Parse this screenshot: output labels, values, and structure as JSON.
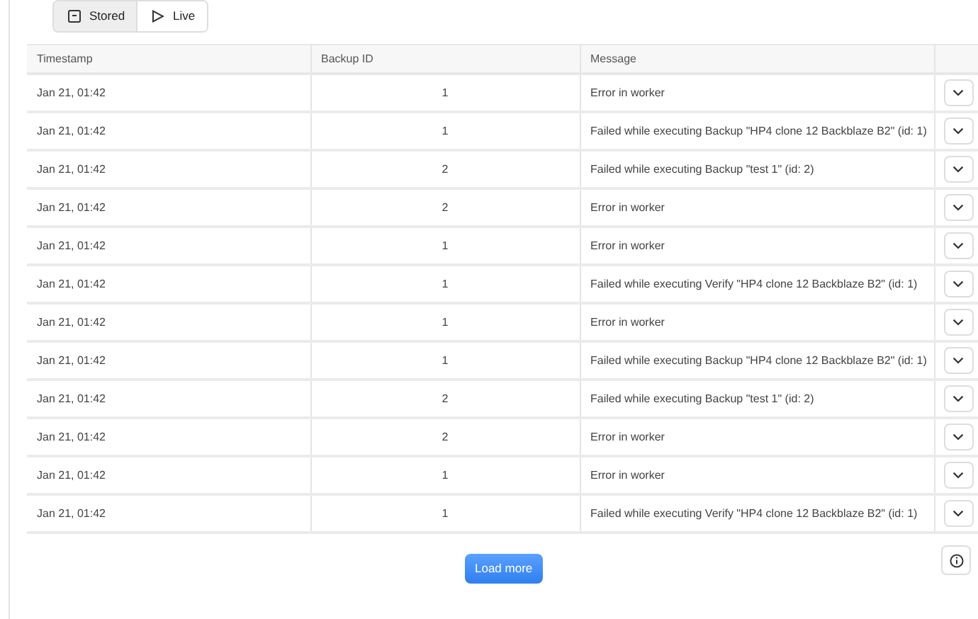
{
  "view_toggle": [
    {
      "label": "Stored",
      "selected": true
    },
    {
      "label": "Live",
      "selected": false
    }
  ],
  "table": {
    "columns": [
      "Timestamp",
      "Backup ID",
      "Message"
    ],
    "rows": [
      {
        "timestamp": "Jan 21, 01:42",
        "backup_id": "1",
        "message": "Error in worker"
      },
      {
        "timestamp": "Jan 21, 01:42",
        "backup_id": "1",
        "message": "Failed while executing Backup \"HP4 clone 12 Backblaze B2\" (id: 1)"
      },
      {
        "timestamp": "Jan 21, 01:42",
        "backup_id": "2",
        "message": "Failed while executing Backup \"test 1\" (id: 2)"
      },
      {
        "timestamp": "Jan 21, 01:42",
        "backup_id": "2",
        "message": "Error in worker"
      },
      {
        "timestamp": "Jan 21, 01:42",
        "backup_id": "1",
        "message": "Error in worker"
      },
      {
        "timestamp": "Jan 21, 01:42",
        "backup_id": "1",
        "message": "Failed while executing Verify \"HP4 clone 12 Backblaze B2\" (id: 1)"
      },
      {
        "timestamp": "Jan 21, 01:42",
        "backup_id": "1",
        "message": "Error in worker"
      },
      {
        "timestamp": "Jan 21, 01:42",
        "backup_id": "1",
        "message": "Failed while executing Backup \"HP4 clone 12 Backblaze B2\" (id: 1)"
      },
      {
        "timestamp": "Jan 21, 01:42",
        "backup_id": "2",
        "message": "Failed while executing Backup \"test 1\" (id: 2)"
      },
      {
        "timestamp": "Jan 21, 01:42",
        "backup_id": "2",
        "message": "Error in worker"
      },
      {
        "timestamp": "Jan 21, 01:42",
        "backup_id": "1",
        "message": "Error in worker"
      },
      {
        "timestamp": "Jan 21, 01:42",
        "backup_id": "1",
        "message": "Failed while executing Verify \"HP4 clone 12 Backblaze B2\" (id: 1)"
      }
    ]
  },
  "load_more": "Load more"
}
